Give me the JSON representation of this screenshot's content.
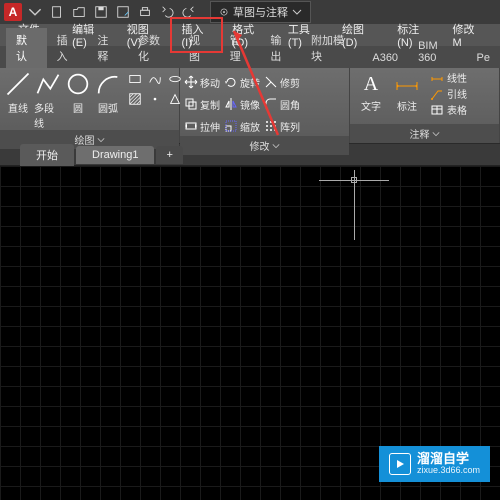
{
  "titlebar": {
    "workspace_label": "草图与注释"
  },
  "menus": {
    "file": "文件(F)",
    "edit": "编辑(E)",
    "view": "视图(V)",
    "insert": "插入(I)",
    "format": "格式(O)",
    "tools": "工具(T)",
    "draw": "绘图(D)",
    "dimension": "标注(N)",
    "modify": "修改M"
  },
  "ribbon_tabs": {
    "default": "默认",
    "insert": "插入",
    "annotate": "注释",
    "parametric": "参数化",
    "view": "视图",
    "manage": "管理",
    "output": "输出",
    "addins": "附加模块",
    "a360": "A360",
    "bim360": "BIM 360",
    "pe": "Pe"
  },
  "draw_panel": {
    "title": "绘图",
    "line": "直线",
    "polyline": "多段线",
    "circle": "圆",
    "arc": "圆弧"
  },
  "modify_panel": {
    "title": "修改",
    "move": "移动",
    "copy": "复制",
    "stretch": "拉伸",
    "rotate": "旋转",
    "mirror": "镜像",
    "scale": "缩放",
    "trim": "修剪",
    "fillet": "圆角",
    "array": "阵列"
  },
  "annotate_panel": {
    "title": "注释",
    "text": "文字",
    "dim": "标注",
    "linear": "线性",
    "leader": "引线",
    "table": "表格"
  },
  "doctabs": {
    "start": "开始",
    "drawing": "Drawing1",
    "add": "+"
  },
  "watermark": {
    "brand": "溜溜自学",
    "url": "zixue.3d66.com"
  }
}
